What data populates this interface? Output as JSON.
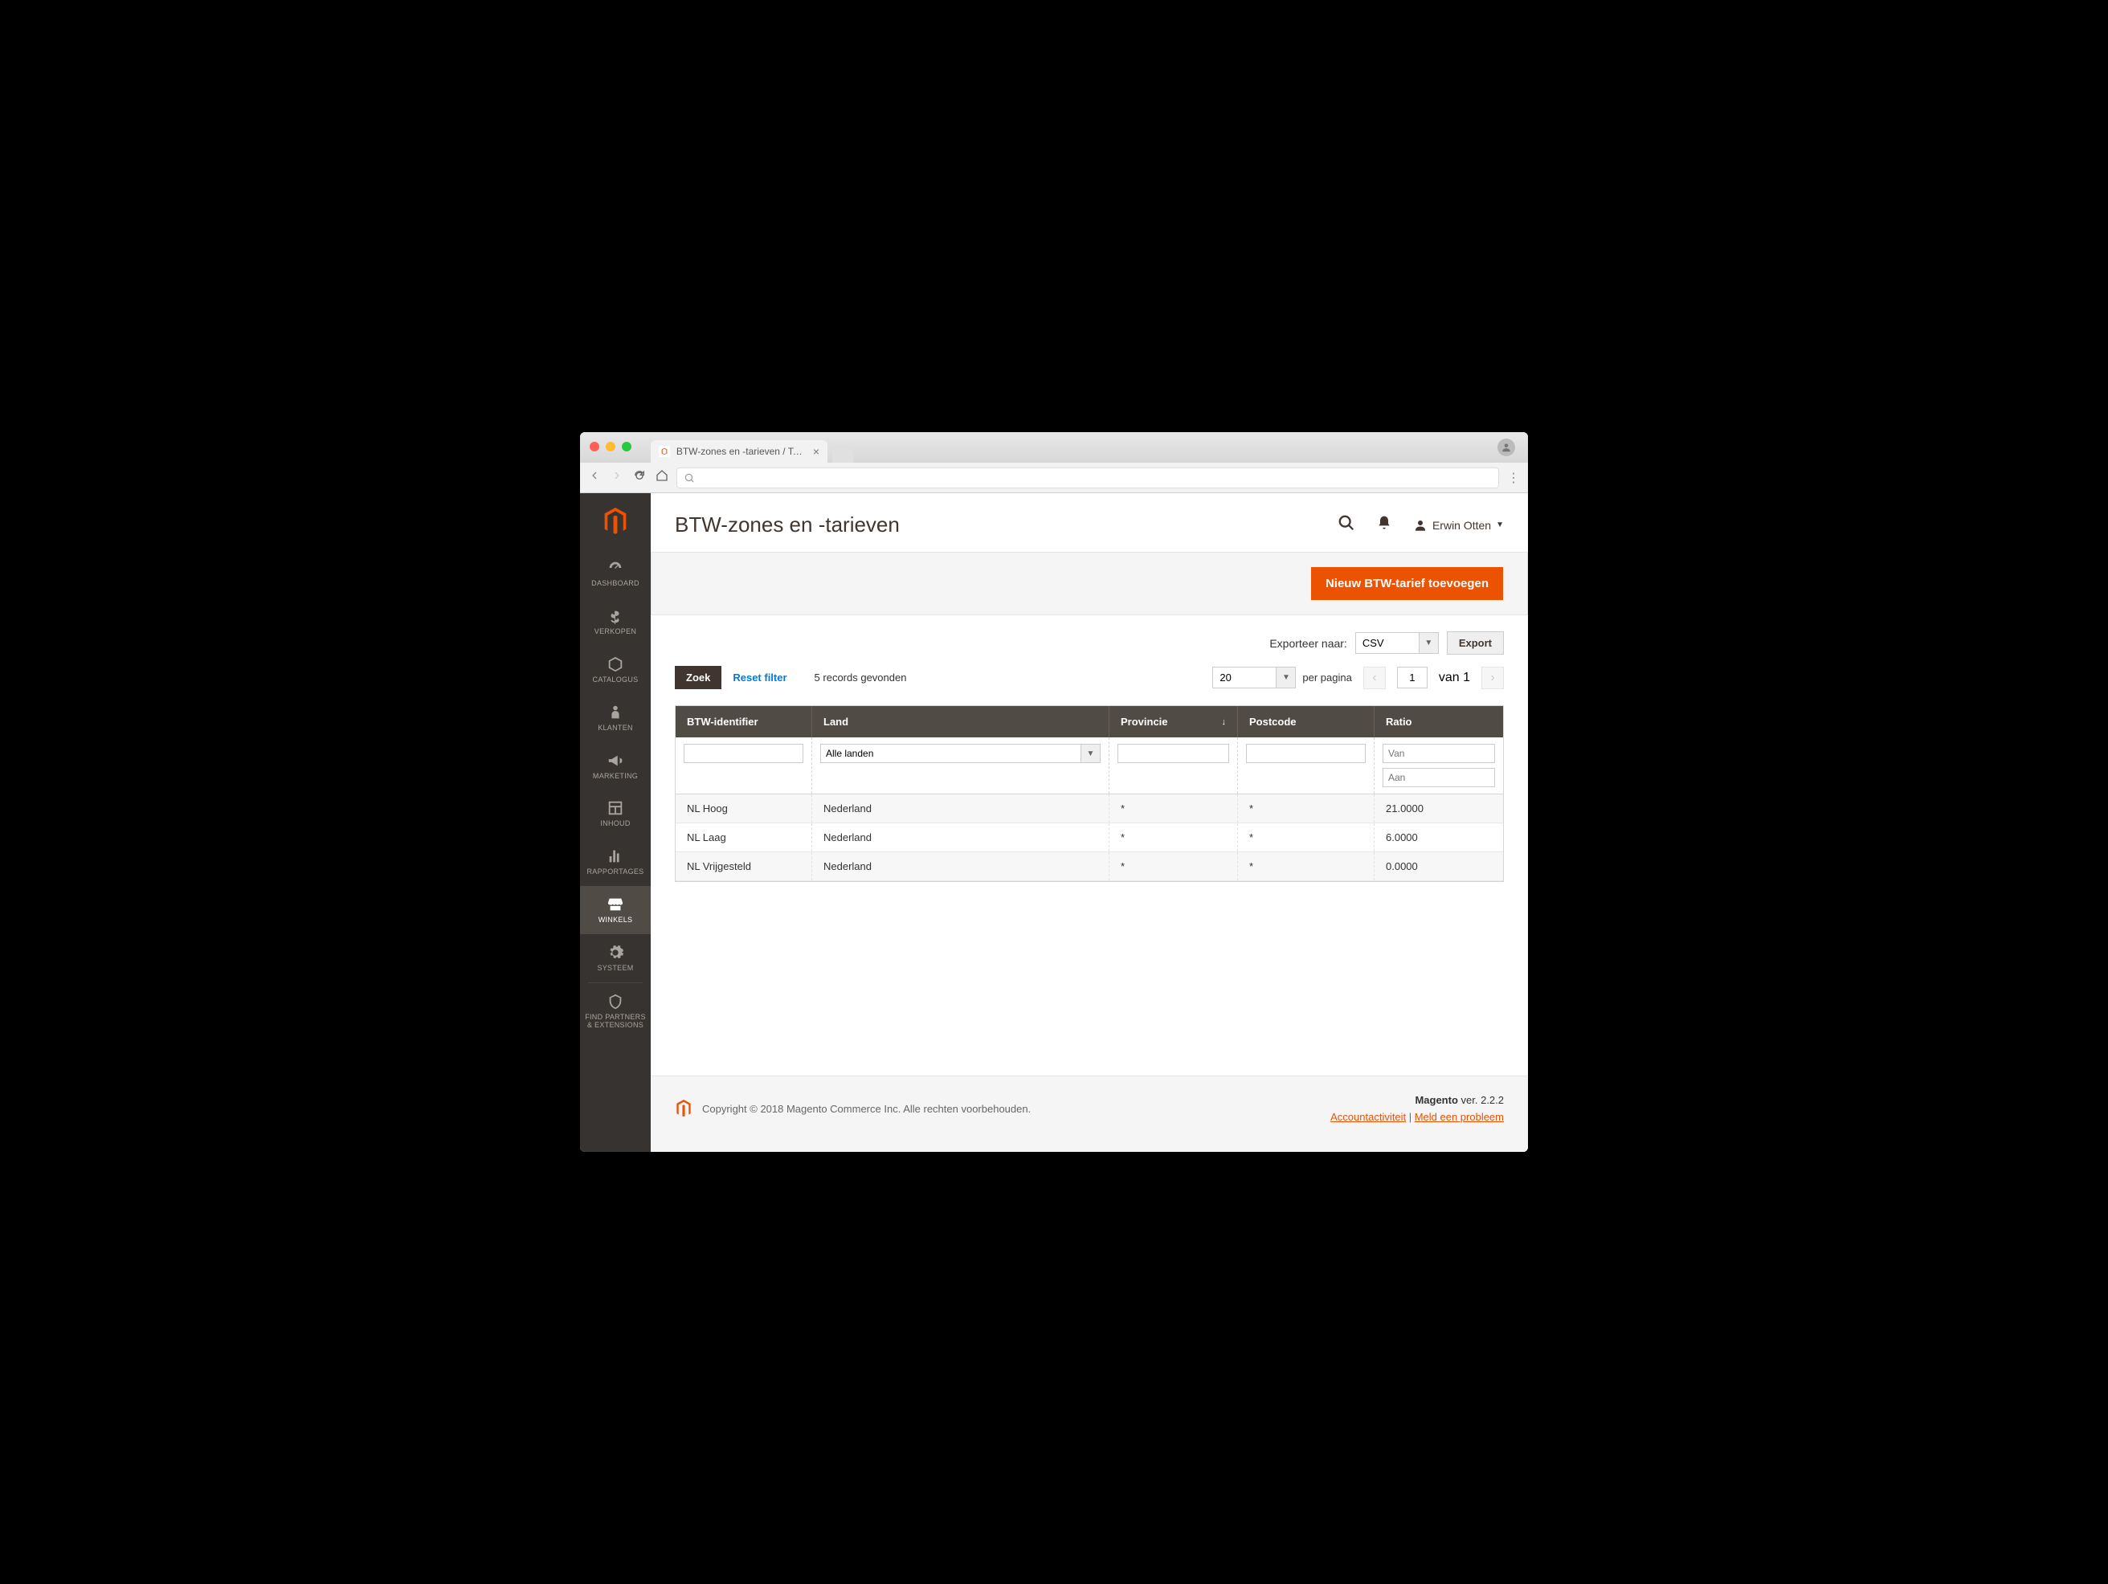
{
  "browser": {
    "tab_title": "BTW-zones en -tarieven / Taxe"
  },
  "sidebar": {
    "items": [
      {
        "label": "DASHBOARD"
      },
      {
        "label": "VERKOPEN"
      },
      {
        "label": "CATALOGUS"
      },
      {
        "label": "KLANTEN"
      },
      {
        "label": "MARKETING"
      },
      {
        "label": "INHOUD"
      },
      {
        "label": "RAPPORTAGES"
      },
      {
        "label": "WINKELS"
      },
      {
        "label": "SYSTEEM"
      },
      {
        "label": "FIND PARTNERS & EXTENSIONS"
      }
    ]
  },
  "header": {
    "title": "BTW-zones en -tarieven",
    "user": "Erwin Otten"
  },
  "action_bar": {
    "primary": "Nieuw BTW-tarief toevoegen"
  },
  "export": {
    "label": "Exporteer naar:",
    "format": "CSV",
    "button": "Export"
  },
  "grid_controls": {
    "search": "Zoek",
    "reset": "Reset filter",
    "records": "5 records gevonden",
    "per_page_value": "20",
    "per_page_label": "per pagina",
    "page": "1",
    "page_total": "van 1"
  },
  "grid": {
    "columns": [
      "BTW-identifier",
      "Land",
      "Provincie",
      "Postcode",
      "Ratio"
    ],
    "filter_land": "Alle landen",
    "filter_ratio_from": "Van",
    "filter_ratio_to": "Aan",
    "rows": [
      {
        "id": "NL Hoog",
        "land": "Nederland",
        "prov": "*",
        "post": "*",
        "ratio": "21.0000"
      },
      {
        "id": "NL Laag",
        "land": "Nederland",
        "prov": "*",
        "post": "*",
        "ratio": "6.0000"
      },
      {
        "id": "NL Vrijgesteld",
        "land": "Nederland",
        "prov": "*",
        "post": "*",
        "ratio": "0.0000"
      }
    ]
  },
  "footer": {
    "copyright": "Copyright © 2018 Magento Commerce Inc. Alle rechten voorbehouden.",
    "product": "Magento",
    "version": " ver. 2.2.2",
    "link_activity": "Accountactiviteit",
    "link_problem": "Meld een probleem"
  }
}
